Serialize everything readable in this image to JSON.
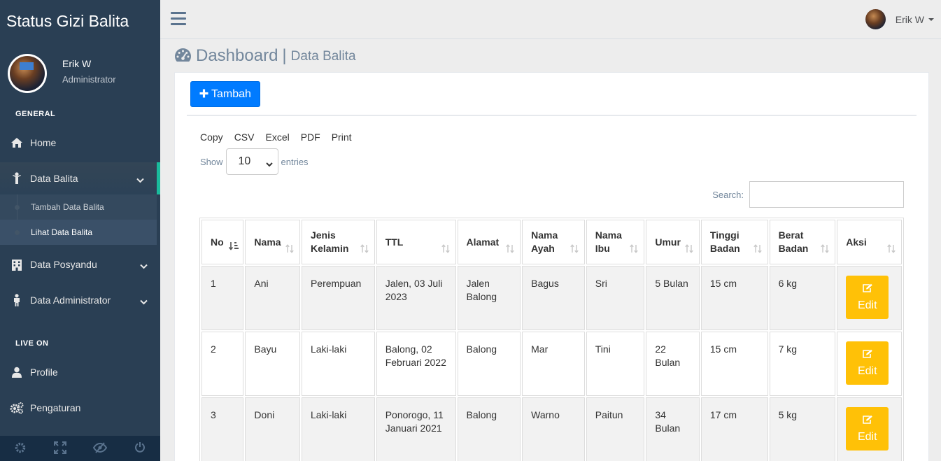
{
  "brand": "Status Gizi Balita",
  "user": {
    "name": "Erik W",
    "role": "Administrator"
  },
  "sections": {
    "general": "GENERAL",
    "live_on": "LIVE ON"
  },
  "menu": {
    "home": "Home",
    "data_balita": "Data Balita",
    "tambah_data_balita": "Tambah Data Balita",
    "lihat_data_balita": "Lihat Data Balita",
    "data_posyandu": "Data Posyandu",
    "data_administrator": "Data Administrator",
    "profile": "Profile",
    "pengaturan": "Pengaturan"
  },
  "header": {
    "title": "Dashboard",
    "separator": "|",
    "subtitle": "Data Balita"
  },
  "toolbar": {
    "add_label": "Tambah",
    "export": [
      "Copy",
      "CSV",
      "Excel",
      "PDF",
      "Print"
    ]
  },
  "length": {
    "show": "Show",
    "value": "10",
    "entries": "entries"
  },
  "search": {
    "label": "Search:",
    "value": ""
  },
  "table": {
    "headers": [
      "No",
      "Nama",
      "Jenis Kelamin",
      "TTL",
      "Alamat",
      "Nama Ayah",
      "Nama Ibu",
      "Umur",
      "Tinggi Badan",
      "Berat Badan",
      "Aksi"
    ],
    "edit_label": "Edit",
    "rows": [
      [
        "1",
        "Ani",
        "Perempuan",
        "Jalen, 03 Juli 2023",
        "Jalen Balong",
        "Bagus",
        "Sri",
        "5 Bulan",
        "15 cm",
        "6 kg"
      ],
      [
        "2",
        "Bayu",
        "Laki-laki",
        "Balong, 02 Februari 2022",
        "Balong",
        "Mar",
        "Tini",
        "22 Bulan",
        "15 cm",
        "7 kg"
      ],
      [
        "3",
        "Doni",
        "Laki-laki",
        "Ponorogo, 11 Januari 2021",
        "Balong",
        "Warno",
        "Paitun",
        "34 Bulan",
        "17 cm",
        "5 kg"
      ]
    ]
  },
  "colors": {
    "sidebar": "#2a3f54",
    "accent": "#1abb9c",
    "primary": "#007bff",
    "warning": "#ffc107"
  }
}
